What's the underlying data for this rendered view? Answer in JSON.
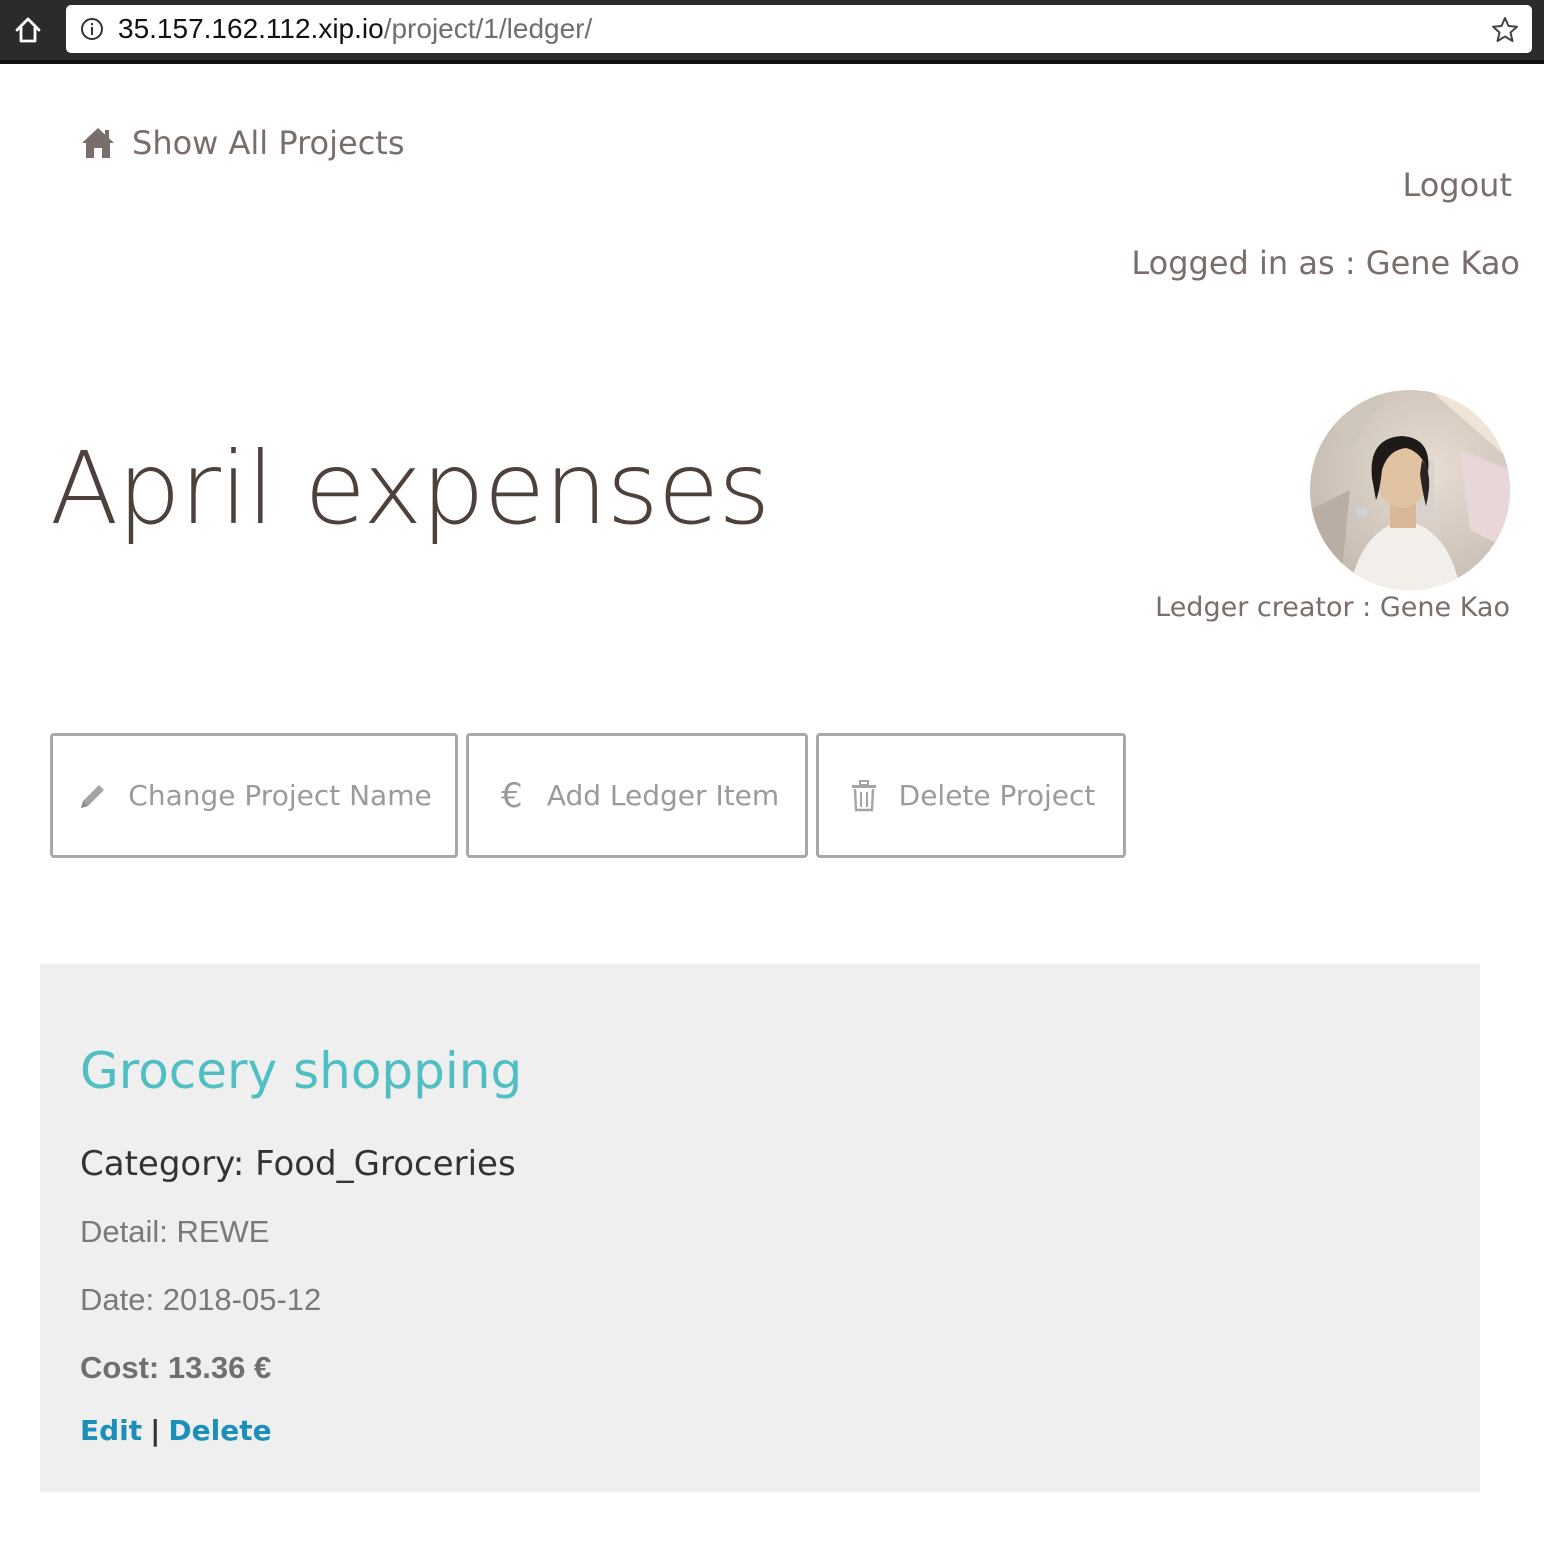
{
  "browser": {
    "url_host": "35.157.162.112.xip.io",
    "url_path": "/project/1/ledger/"
  },
  "nav": {
    "home_label": "Show All Projects",
    "logout_label": "Logout",
    "logged_in_text": "Logged in as : Gene Kao"
  },
  "project": {
    "title": "April expenses",
    "creator_text": "Ledger creator : Gene Kao"
  },
  "actions": {
    "change_name": "Change Project Name",
    "add_item": "Add Ledger Item",
    "delete_project": "Delete Project"
  },
  "ledger_items": [
    {
      "title": "Grocery shopping",
      "category": "Category: Food_Groceries",
      "detail": "Detail: REWE",
      "date": "Date: 2018-05-12",
      "cost": "Cost: 13.36 €",
      "edit_label": "Edit",
      "separator": "|",
      "delete_label": "Delete"
    }
  ],
  "colors": {
    "accent_teal": "#4fbfc4",
    "link_blue": "#1b8fb8",
    "title_brown": "#4d413c",
    "muted_text": "#7a6e6b",
    "card_bg": "#efefef"
  },
  "icons": {
    "browser_home": "home-icon",
    "site_info": "info-icon",
    "bookmark": "star-icon",
    "nav_home": "house-icon",
    "change_name": "pencil-icon",
    "add_item": "euro-icon",
    "delete_project": "trash-icon"
  }
}
